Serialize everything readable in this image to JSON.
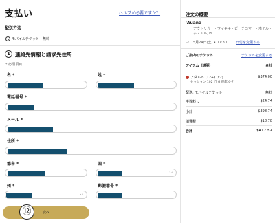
{
  "checkout": {
    "title": "支払い",
    "help_link": "ヘルプが必要ですか？",
    "delivery": {
      "label": "配送方法",
      "option": "モバイルチケット - 無料"
    },
    "contact": {
      "step_number": "1",
      "title": "連絡先情報と請求先住所",
      "required_note": "* 必須項目"
    },
    "fields": {
      "first_name": "名 *",
      "last_name": "姓 *",
      "phone": "電話番号 *",
      "email": "メール *",
      "address": "住所 *",
      "city": "都市 *",
      "country": "国 *",
      "state": "州 *",
      "postal": "郵便番号 *"
    },
    "next_button": "次へ",
    "badge_number": "⑫"
  },
  "summary": {
    "title": "注文の概要",
    "venue_name": "'Auana",
    "venue_address": "アウトリガー・ワイキキ・ビーチコマー・ホテル・ホノルル, HI",
    "date_time": "5月24日(土) • 17:30",
    "change_date_link": "日付を変更する",
    "tickets_label": "ご案内のチケット",
    "change_tickets_link": "チケットを変更する",
    "items_header": "アイテム（説明）",
    "total_header": "合計",
    "ticket_line": "アダルト (12+) (x2)",
    "ticket_price": "$374.00",
    "ticket_detail": "セクション 102 行 G 座席 6-7",
    "delivery_label": "配送: モバイルチケット",
    "delivery_value": "無料",
    "fees_label": "手数料",
    "fees_value": "$24.74",
    "subtotal_label": "小計",
    "subtotal_value": "$398.74",
    "tax_label": "消費税",
    "tax_value": "$18.78",
    "total_label": "合計",
    "total_value": "$417.52"
  }
}
